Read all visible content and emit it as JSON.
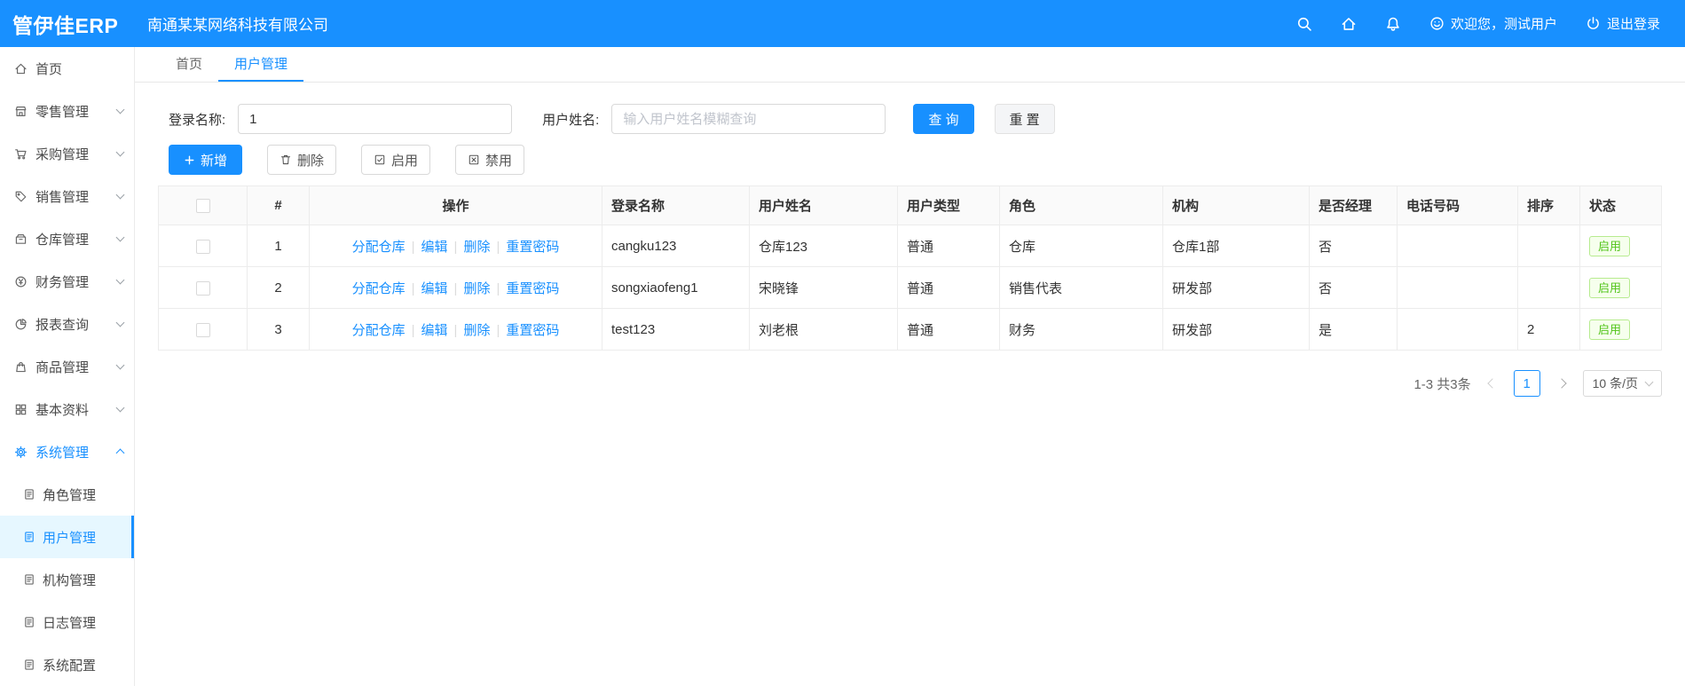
{
  "topbar": {
    "logo": "管伊佳ERP",
    "company": "南通某某网络科技有限公司",
    "welcome": "欢迎您，测试用户",
    "logout": "退出登录"
  },
  "icons": {
    "topbar": [
      "search-icon",
      "home-icon",
      "bell-icon",
      "smile-icon",
      "logout-icon"
    ],
    "toolbar": [
      "plus-icon",
      "trash-icon",
      "check-square-icon",
      "x-square-icon"
    ]
  },
  "sidebar": {
    "items": [
      {
        "label": "首页",
        "icon": "home-icon"
      },
      {
        "label": "零售管理",
        "icon": "retail-icon"
      },
      {
        "label": "采购管理",
        "icon": "purchase-icon"
      },
      {
        "label": "销售管理",
        "icon": "sales-icon"
      },
      {
        "label": "仓库管理",
        "icon": "warehouse-icon"
      },
      {
        "label": "财务管理",
        "icon": "finance-icon"
      },
      {
        "label": "报表查询",
        "icon": "report-icon"
      },
      {
        "label": "商品管理",
        "icon": "goods-icon"
      },
      {
        "label": "基本资料",
        "icon": "basic-data-icon"
      },
      {
        "label": "系统管理",
        "icon": "system-icon"
      }
    ],
    "submenu": [
      {
        "label": "角色管理",
        "icon": "doc-icon"
      },
      {
        "label": "用户管理",
        "icon": "doc-icon"
      },
      {
        "label": "机构管理",
        "icon": "doc-icon"
      },
      {
        "label": "日志管理",
        "icon": "doc-icon"
      },
      {
        "label": "系统配置",
        "icon": "doc-icon"
      }
    ]
  },
  "tabs": [
    {
      "label": "首页"
    },
    {
      "label": "用户管理"
    }
  ],
  "filters": {
    "login_name_label": "登录名称:",
    "login_name_value": "1",
    "user_name_label": "用户姓名:",
    "user_name_placeholder": "输入用户姓名模糊查询",
    "search_button": "查 询",
    "reset_button": "重 置"
  },
  "toolbar": {
    "add": "新增",
    "delete": "删除",
    "enable": "启用",
    "disable": "禁用"
  },
  "table": {
    "columns": [
      "#",
      "操作",
      "登录名称",
      "用户姓名",
      "用户类型",
      "角色",
      "机构",
      "是否经理",
      "电话号码",
      "排序",
      "状态"
    ],
    "action_labels": [
      "分配仓库",
      "编辑",
      "删除",
      "重置密码"
    ],
    "action_separator": "|",
    "rows": [
      {
        "index": "1",
        "login_name": "cangku123",
        "user_name": "仓库123",
        "user_type": "普通",
        "role": "仓库",
        "org": "仓库1部",
        "is_manager": "否",
        "phone": "",
        "sort": "",
        "status": "启用"
      },
      {
        "index": "2",
        "login_name": "songxiaofeng1",
        "user_name": "宋晓锋",
        "user_type": "普通",
        "role": "销售代表",
        "org": "研发部",
        "is_manager": "否",
        "phone": "",
        "sort": "",
        "status": "启用"
      },
      {
        "index": "3",
        "login_name": "test123",
        "user_name": "刘老根",
        "user_type": "普通",
        "role": "财务",
        "org": "研发部",
        "is_manager": "是",
        "phone": "",
        "sort": "2",
        "status": "启用"
      }
    ]
  },
  "pagination": {
    "total_text": "1-3 共3条",
    "current_page": "1",
    "page_size": "10 条/页"
  },
  "colors": {
    "primary": "#1890ff",
    "success": "#52c41a",
    "topbar_bg": "#1890ff",
    "selected_menu_bg": "#e6f7ff"
  }
}
